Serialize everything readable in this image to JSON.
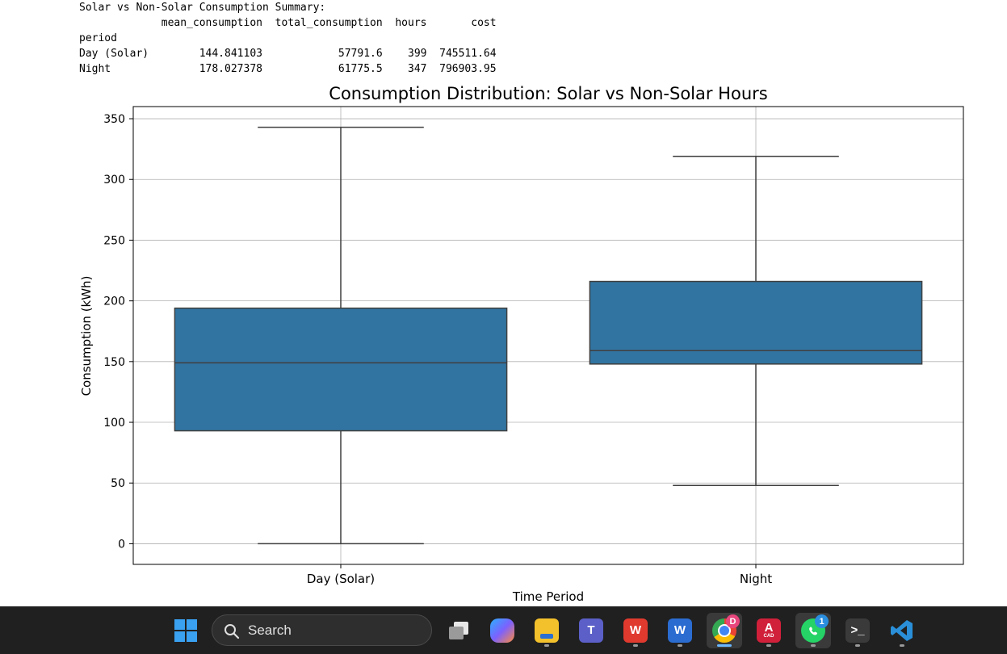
{
  "summary": {
    "heading": "Solar vs Non-Solar Consumption Summary:",
    "columns": [
      "mean_consumption",
      "total_consumption",
      "hours",
      "cost"
    ],
    "index_name": "period",
    "rows": [
      {
        "period": "Day (Solar)",
        "mean_consumption": "144.841103",
        "total_consumption": "57791.6",
        "hours": "399",
        "cost": "745511.64"
      },
      {
        "period": "Night",
        "mean_consumption": "178.027378",
        "total_consumption": "61775.5",
        "hours": "347",
        "cost": "796903.95"
      }
    ]
  },
  "chart_data": {
    "type": "box",
    "title": "Consumption Distribution: Solar vs Non-Solar Hours",
    "xlabel": "Time Period",
    "ylabel": "Consumption (kWh)",
    "ylim": [
      -17,
      360
    ],
    "yticks": [
      0,
      50,
      100,
      150,
      200,
      250,
      300,
      350
    ],
    "categories": [
      "Day (Solar)",
      "Night"
    ],
    "boxes": [
      {
        "category": "Day (Solar)",
        "whisker_low": 0,
        "q1": 93,
        "median": 149,
        "q3": 194,
        "whisker_high": 343
      },
      {
        "category": "Night",
        "whisker_low": 48,
        "q1": 148,
        "median": 159,
        "q3": 216,
        "whisker_high": 319
      }
    ],
    "box_color": "#3274a1",
    "grid": true
  },
  "taskbar": {
    "search_placeholder": "Search",
    "apps": [
      {
        "name": "start",
        "icon": "windows-logo-icon"
      },
      {
        "name": "task-view",
        "icon": "task-view-icon"
      },
      {
        "name": "copilot",
        "icon": "copilot-icon"
      },
      {
        "name": "file-explorer",
        "icon": "folder-icon"
      },
      {
        "name": "teams",
        "icon": "teams-icon",
        "letter": "T"
      },
      {
        "name": "wps-office",
        "icon": "wps-icon",
        "letter": "W"
      },
      {
        "name": "word",
        "icon": "word-icon",
        "letter": "W"
      },
      {
        "name": "chrome",
        "icon": "chrome-icon",
        "badge": "D"
      },
      {
        "name": "autocad",
        "icon": "autocad-icon",
        "letter": "A",
        "sub": "CAD"
      },
      {
        "name": "whatsapp",
        "icon": "whatsapp-icon",
        "badge": "1"
      },
      {
        "name": "terminal",
        "icon": "terminal-icon",
        "letter": ">_"
      },
      {
        "name": "vscode",
        "icon": "vscode-icon"
      }
    ]
  }
}
